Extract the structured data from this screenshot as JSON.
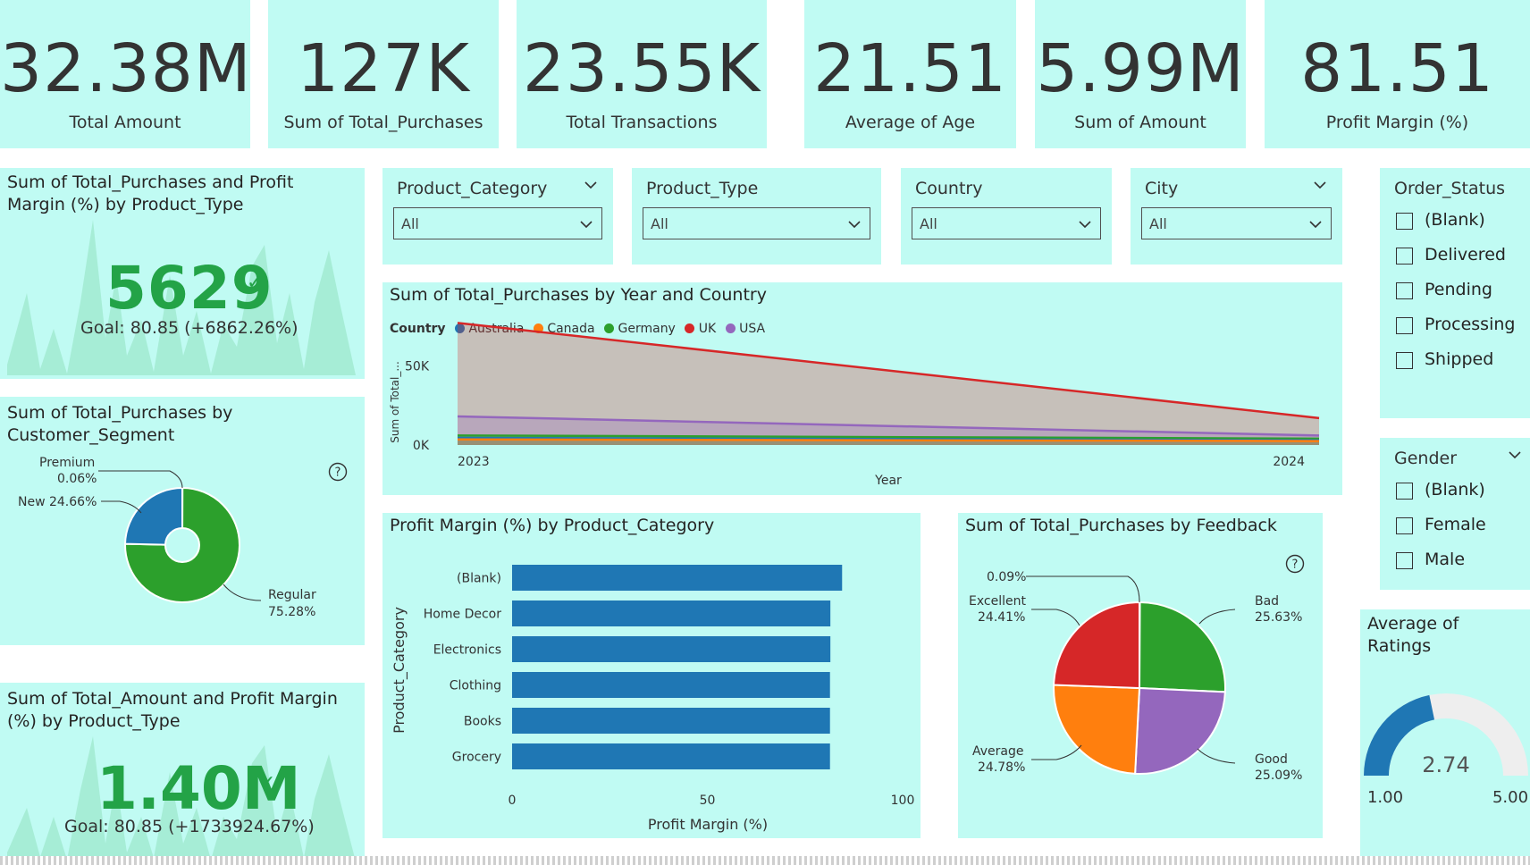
{
  "kpis": [
    {
      "value": "32.38M",
      "label": "Total Amount"
    },
    {
      "value": "127K",
      "label": "Sum of Total_Purchases"
    },
    {
      "value": "23.55K",
      "label": "Total Transactions"
    },
    {
      "value": "21.51",
      "label": "Average of Age"
    },
    {
      "value": "5.99M",
      "label": "Sum of Amount"
    },
    {
      "value": "81.51",
      "label": "Profit Margin (%)"
    }
  ],
  "kpi_cards": {
    "purchases_margin": {
      "title": "Sum of Total_Purchases and Profit Margin (%) by Product_Type",
      "value": "5629",
      "goal": "Goal: 80.85 (+6862.26%)"
    },
    "amount_margin": {
      "title": "Sum of Total_Amount and Profit Margin (%) by Product_Type",
      "value": "1.40M",
      "goal": "Goal: 80.85 (+1733924.67%)"
    }
  },
  "slicers": {
    "product_category": {
      "title": "Product_Category",
      "value": "All"
    },
    "product_type": {
      "title": "Product_Type",
      "value": "All"
    },
    "country": {
      "title": "Country",
      "value": "All"
    },
    "city": {
      "title": "City",
      "value": "All"
    },
    "order_status": {
      "title": "Order_Status",
      "items": [
        "(Blank)",
        "Delivered",
        "Pending",
        "Processing",
        "Shipped"
      ]
    },
    "gender": {
      "title": "Gender",
      "items": [
        "(Blank)",
        "Female",
        "Male"
      ]
    }
  },
  "colors": {
    "panel": "#c0fbf3",
    "australia": "#1f77b4",
    "canada": "#ff7f0e",
    "germany": "#2ca02c",
    "uk": "#d62728",
    "usa": "#9467bd",
    "bar": "#1f77b4",
    "kpi_green": "#23a347",
    "gauge_track": "#eeeeee"
  },
  "chart_data": [
    {
      "id": "segment",
      "type": "pie",
      "title": "Sum of Total_Purchases by Customer_Segment",
      "labels": [
        "Premium",
        "New",
        "Regular"
      ],
      "values": [
        0.06,
        24.66,
        75.28
      ],
      "label_text": [
        "Premium 0.06%",
        "New 24.66%",
        "Regular 75.28%"
      ],
      "colors": [
        "#d62728",
        "#1f77b4",
        "#2ca02c"
      ],
      "donut": true
    },
    {
      "id": "year_country",
      "type": "area",
      "title": "Sum of Total_Purchases by Year and Country",
      "legend_title": "Country",
      "xlabel": "Year",
      "ylabel": "Sum of Total_...",
      "x": [
        "2023",
        "2024"
      ],
      "ylim": [
        0,
        80000
      ],
      "yticks": [
        {
          "v": 0,
          "label": "0K"
        },
        {
          "v": 50000,
          "label": "50K"
        }
      ],
      "series": [
        {
          "name": "Australia",
          "values": [
            4500,
            3000
          ],
          "color": "#1f77b4"
        },
        {
          "name": "Canada",
          "values": [
            3500,
            2500
          ],
          "color": "#ff7f0e"
        },
        {
          "name": "Germany",
          "values": [
            6000,
            4000
          ],
          "color": "#2ca02c"
        },
        {
          "name": "UK",
          "values": [
            77000,
            17000
          ],
          "color": "#d62728"
        },
        {
          "name": "USA",
          "values": [
            18000,
            6000
          ],
          "color": "#9467bd"
        }
      ]
    },
    {
      "id": "margin_category",
      "type": "bar",
      "orientation": "horizontal",
      "title": "Profit Margin (%) by Product_Category",
      "xlabel": "Profit Margin (%)",
      "ylabel": "Product_Category",
      "categories": [
        "(Blank)",
        "Home Decor",
        "Electronics",
        "Clothing",
        "Books",
        "Grocery"
      ],
      "values": [
        84.5,
        81.5,
        81.5,
        81.4,
        81.4,
        81.4
      ],
      "xlim": [
        0,
        100
      ],
      "xticks": [
        0,
        50,
        100
      ]
    },
    {
      "id": "feedback",
      "type": "pie",
      "title": "Sum of Total_Purchases by Feedback",
      "labels": [
        "",
        "Bad",
        "Good",
        "Average",
        "Excellent"
      ],
      "values": [
        0.09,
        25.63,
        25.09,
        24.78,
        24.41
      ],
      "label_text": [
        "0.09%",
        "Bad 25.63%",
        "Good 25.09%",
        "Average 24.78%",
        "Excellent 24.41%"
      ],
      "colors": [
        "#bcbd22",
        "#2ca02c",
        "#9467bd",
        "#ff7f0e",
        "#d62728"
      ]
    },
    {
      "id": "ratings",
      "type": "gauge",
      "title": "Average of Ratings",
      "value": 2.74,
      "min": 1.0,
      "max": 5.0,
      "value_label": "2.74",
      "min_label": "1.00",
      "max_label": "5.00"
    }
  ]
}
